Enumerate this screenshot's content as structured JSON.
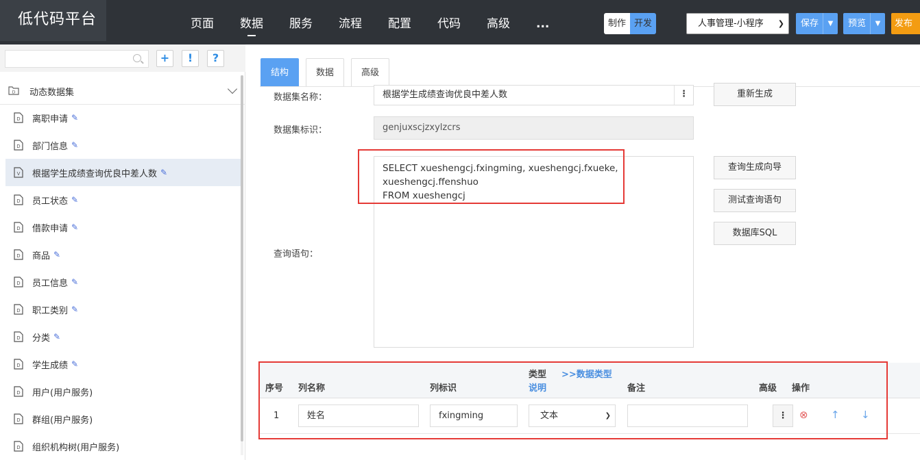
{
  "app": {
    "logo": "低代码平台"
  },
  "nav": [
    "页面",
    "数据",
    "服务",
    "流程",
    "配置",
    "代码",
    "高级",
    "..."
  ],
  "mode": {
    "make": "制作",
    "dev": "开发"
  },
  "app_select": "人事管理-小程序",
  "buttons": {
    "save": "保存",
    "preview": "预览",
    "publish": "发布"
  },
  "sidebar": {
    "tools": {
      "add": "+",
      "info": "!",
      "help": "?"
    },
    "group": "动态数据集",
    "items": [
      {
        "label": "离职申请",
        "icon": "D"
      },
      {
        "label": "部门信息",
        "icon": "D"
      },
      {
        "label": "根据学生成绩查询优良中差人数",
        "icon": "V"
      },
      {
        "label": "员工状态",
        "icon": "D"
      },
      {
        "label": "借款申请",
        "icon": "D"
      },
      {
        "label": "商品",
        "icon": "D"
      },
      {
        "label": "员工信息",
        "icon": "D"
      },
      {
        "label": "职工类别",
        "icon": "D"
      },
      {
        "label": "分类",
        "icon": "D"
      },
      {
        "label": "学生成绩",
        "icon": "D"
      },
      {
        "label": "用户(用户服务)",
        "icon": "D"
      },
      {
        "label": "群组(用户服务)",
        "icon": "D"
      },
      {
        "label": "组织机构树(用户服务)",
        "icon": "D"
      }
    ]
  },
  "tabs": [
    "结构",
    "数据",
    "高级"
  ],
  "form": {
    "name_label": "数据集名称：",
    "name_value": "根据学生成绩查询优良中差人数",
    "id_label": "数据集标识：",
    "id_value": "genjuxscjzxylzcrs",
    "query_label": "查询语句：",
    "sql": "SELECT xueshengcj.fxingming, xueshengcj.fxueke,\nxueshengcj.ffenshuo\nFROM xueshengcj"
  },
  "actions": {
    "regen": "重新生成",
    "wizard": "查询生成向导",
    "test": "测试查询语句",
    "dbsql": "数据库SQL"
  },
  "grid": {
    "headers": {
      "seq": "序号",
      "col_name": "列名称",
      "col_id": "列标识",
      "type": "类型",
      "type_link": ">>数据类型",
      "desc": "说明",
      "remark": "备注",
      "advanced": "高级",
      "ops": "操作"
    },
    "rows": [
      {
        "seq": "1",
        "name": "姓名",
        "id": "fxingming",
        "type": "文本",
        "remark": ""
      }
    ]
  }
}
